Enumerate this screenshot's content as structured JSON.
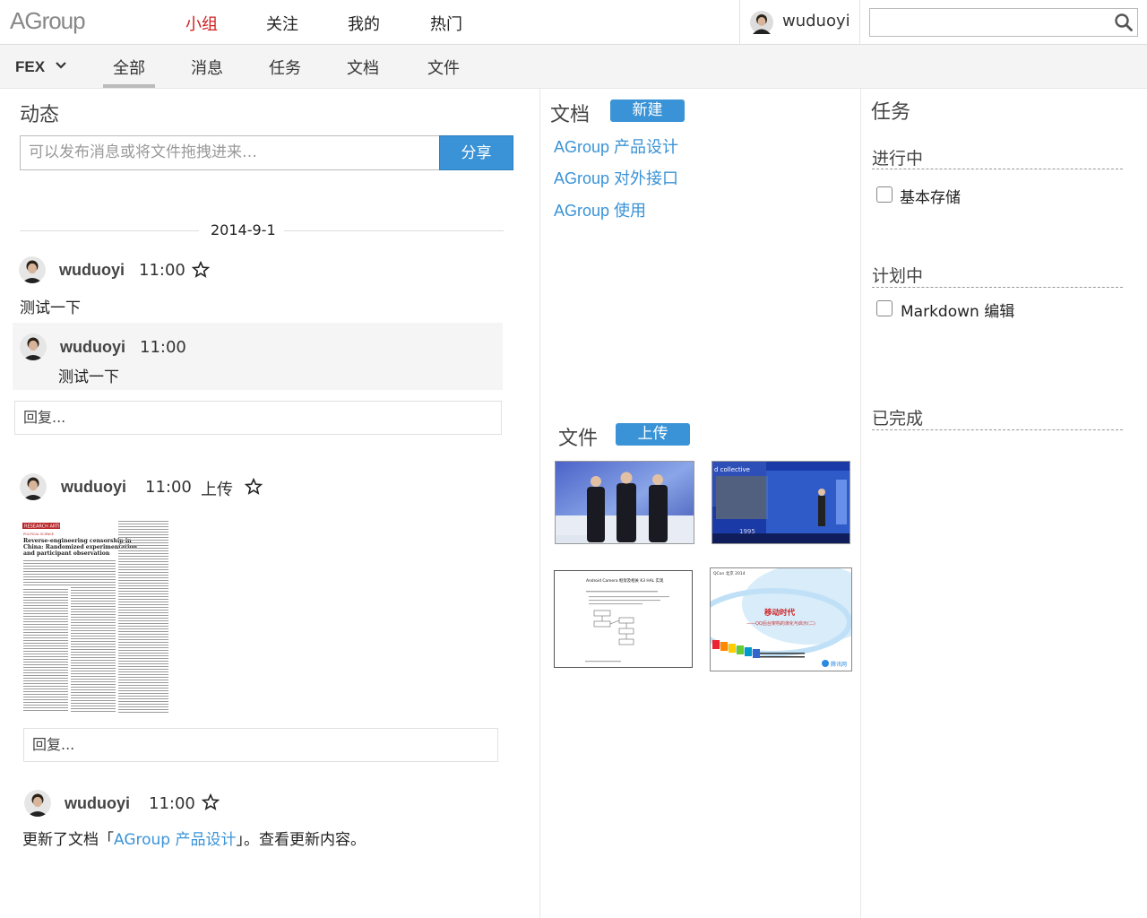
{
  "app": {
    "logo": "AGroup"
  },
  "topnav": [
    "小组",
    "关注",
    "我的",
    "热门"
  ],
  "user": {
    "name": "wuduoyi"
  },
  "search": {
    "placeholder": ""
  },
  "group": {
    "name": "FEX"
  },
  "subnav": [
    "全部",
    "消息",
    "任务",
    "文档",
    "文件"
  ],
  "feed": {
    "title": "动态",
    "share_placeholder": "可以发布消息或将文件拖拽进来…",
    "share_button": "分享",
    "date": "2014-9-1",
    "post1": {
      "author": "wuduoyi",
      "time": "11:00",
      "text": "测试一下"
    },
    "reply1": {
      "author": "wuduoyi",
      "time": "11:00",
      "text": "测试一下"
    },
    "reply_placeholder": "回复...",
    "post2": {
      "author": "wuduoyi",
      "time": "11:00",
      "action": "上传"
    },
    "paper": {
      "label": "RESEARCH ARTICLE",
      "kicker": "POLITICAL SCIENCE",
      "title_line1": "Reverse-engineering censorship in",
      "title_line2": "China: Randomized experimentation",
      "title_line3": "and participant observation"
    },
    "reply2_placeholder": "回复...",
    "post3": {
      "author": "wuduoyi",
      "time": "11:00",
      "text_prefix": "更新了文档「",
      "doc_link": "AGroup 产品设计",
      "text_suffix": "」。查看更新内容。"
    }
  },
  "docs": {
    "title": "文档",
    "new_button": "新建",
    "items": [
      "AGroup 产品设计",
      "AGroup 对外接口",
      "AGroup 使用"
    ]
  },
  "files": {
    "title": "文件",
    "upload_button": "上传",
    "thumb2_caption": "d collective",
    "thumb2_year": "1995",
    "thumb3_title": "Android Camera 框架及相关 K3 HAL 实现",
    "thumb4_header": "QCon 北京 2014",
    "thumb4_title": "移动时代",
    "thumb4_subtitle": "——QQ后台架构的演化与启示(二)",
    "thumb4_brand": "腾讯网"
  },
  "tasks": {
    "title": "任务",
    "in_progress": "进行中",
    "in_progress_items": [
      "基本存储"
    ],
    "planned": "计划中",
    "planned_items": [
      "Markdown 编辑"
    ],
    "done": "已完成"
  },
  "colors": {
    "accent": "#3a93d6",
    "active_nav": "#d02020"
  }
}
